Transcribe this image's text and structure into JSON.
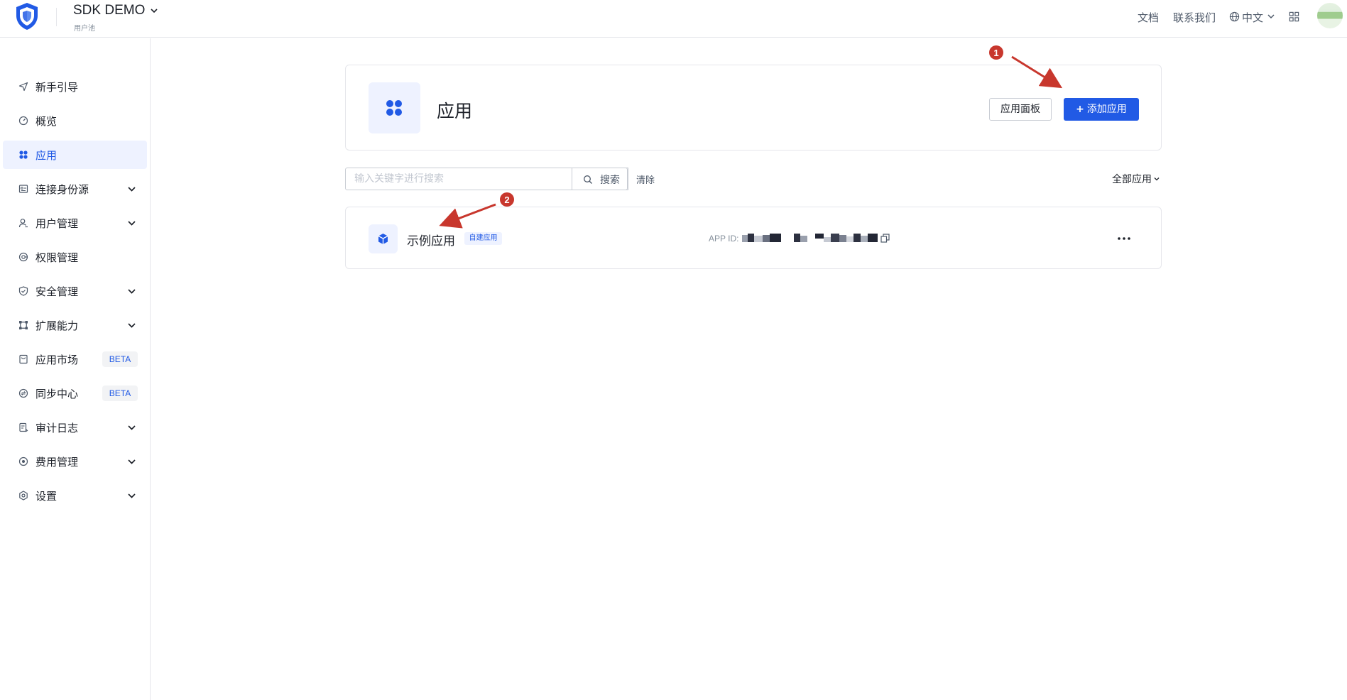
{
  "header": {
    "pool_name": "SDK DEMO",
    "pool_subtitle": "用户池",
    "links": [
      {
        "label": "文档"
      },
      {
        "label": "联系我们"
      }
    ],
    "language": "中文"
  },
  "sidebar": {
    "items": [
      {
        "label": "新手引导",
        "icon": "send-icon"
      },
      {
        "label": "概览",
        "icon": "dashboard-icon"
      },
      {
        "label": "应用",
        "icon": "apps-icon",
        "active": true
      },
      {
        "label": "连接身份源",
        "icon": "identity-source-icon",
        "expandable": true
      },
      {
        "label": "用户管理",
        "icon": "user-icon",
        "expandable": true
      },
      {
        "label": "权限管理",
        "icon": "permission-icon"
      },
      {
        "label": "安全管理",
        "icon": "shield-icon",
        "expandable": true
      },
      {
        "label": "扩展能力",
        "icon": "extension-icon",
        "expandable": true
      },
      {
        "label": "应用市场",
        "icon": "market-icon",
        "badge": "BETA"
      },
      {
        "label": "同步中心",
        "icon": "sync-icon",
        "badge": "BETA"
      },
      {
        "label": "审计日志",
        "icon": "log-icon",
        "expandable": true
      },
      {
        "label": "费用管理",
        "icon": "billing-icon",
        "expandable": true
      },
      {
        "label": "设置",
        "icon": "settings-icon",
        "expandable": true
      }
    ]
  },
  "main": {
    "title": "应用",
    "panel_button": "应用面板",
    "add_button": "添加应用",
    "search": {
      "placeholder": "输入关键字进行搜索",
      "button": "搜索",
      "clear": "清除"
    },
    "filter": "全部应用",
    "apps": [
      {
        "name": "示例应用",
        "tag": "自建应用",
        "app_id_label": "APP ID:"
      }
    ]
  },
  "annotations": {
    "markers": [
      "1",
      "2"
    ],
    "color": "#c8372d"
  },
  "colors": {
    "primary": "#215ae5",
    "active_bg": "#eef2ff",
    "border": "#e5e6eb"
  }
}
